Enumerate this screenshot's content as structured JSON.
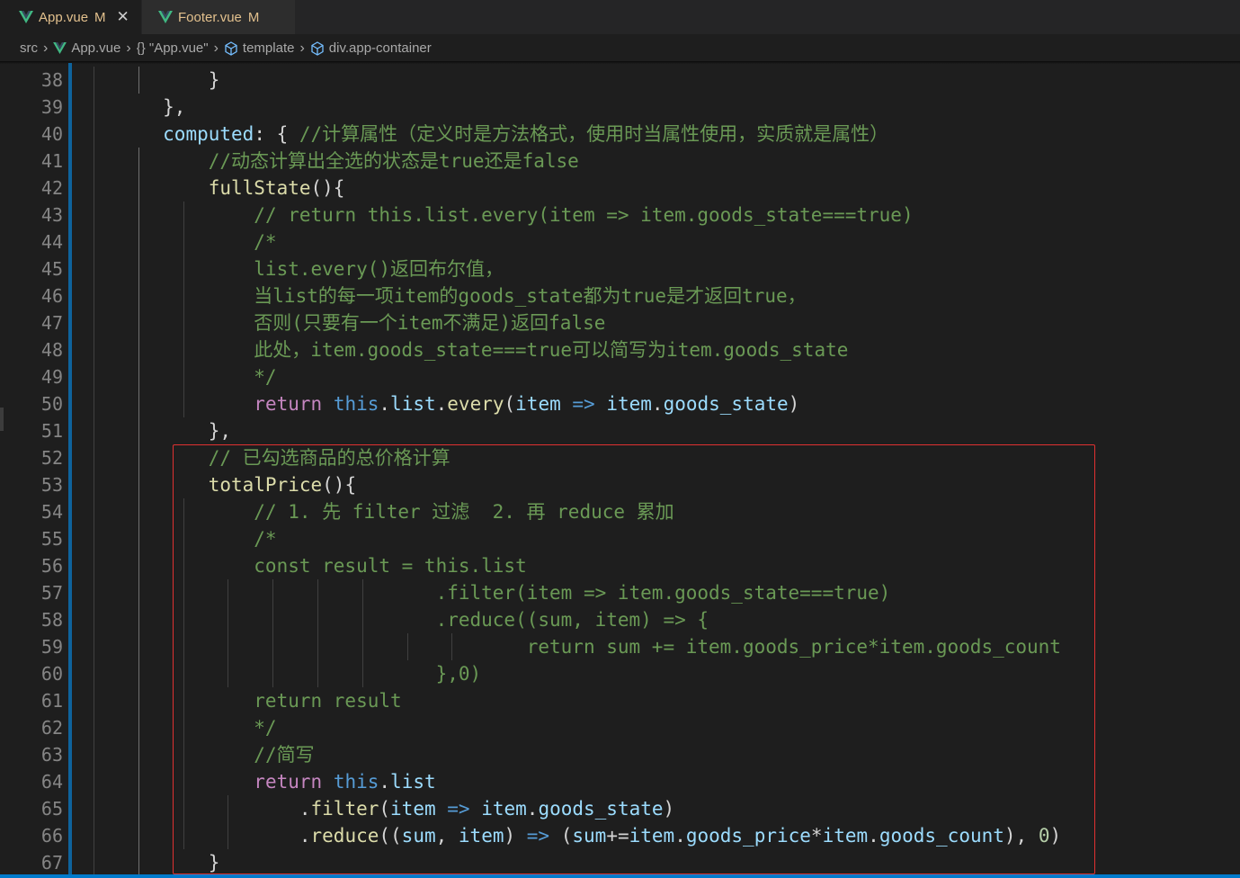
{
  "tabs": [
    {
      "name": "App.vue",
      "status": "M",
      "close": "✕"
    },
    {
      "name": "Footer.vue",
      "status": "M"
    }
  ],
  "breadcrumb": [
    "src",
    "App.vue",
    "{} \"App.vue\"",
    "template",
    "div.app-container"
  ],
  "lines": [
    {
      "n": "38",
      "text": "            }"
    },
    {
      "n": "39",
      "text": "        },"
    },
    {
      "n": "40",
      "text": "        computed: { //计算属性（定义时是方法格式，使用时当属性使用，实质就是属性）"
    },
    {
      "n": "41",
      "text": "            //动态计算出全选的状态是true还是false"
    },
    {
      "n": "42",
      "text": "            fullState(){"
    },
    {
      "n": "43",
      "text": "                // return this.list.every(item => item.goods_state===true)"
    },
    {
      "n": "44",
      "text": "                /*"
    },
    {
      "n": "45",
      "text": "                list.every()返回布尔值，"
    },
    {
      "n": "46",
      "text": "                当list的每一项item的goods_state都为true是才返回true，"
    },
    {
      "n": "47",
      "text": "                否则(只要有一个item不满足)返回false"
    },
    {
      "n": "48",
      "text": "                此处，item.goods_state===true可以简写为item.goods_state"
    },
    {
      "n": "49",
      "text": "                */"
    },
    {
      "n": "50",
      "text": "                return this.list.every(item => item.goods_state)"
    },
    {
      "n": "51",
      "text": "            },"
    },
    {
      "n": "52",
      "text": "            // 已勾选商品的总价格计算"
    },
    {
      "n": "53",
      "text": "            totalPrice(){"
    },
    {
      "n": "54",
      "text": "                // 1. 先 filter 过滤  2. 再 reduce 累加"
    },
    {
      "n": "55",
      "text": "                /*"
    },
    {
      "n": "56",
      "text": "                const result = this.list"
    },
    {
      "n": "57",
      "text": "                                .filter(item => item.goods_state===true)"
    },
    {
      "n": "58",
      "text": "                                .reduce((sum, item) => {"
    },
    {
      "n": "59",
      "text": "                                        return sum += item.goods_price*item.goods_count"
    },
    {
      "n": "60",
      "text": "                                },0)"
    },
    {
      "n": "61",
      "text": "                return result"
    },
    {
      "n": "62",
      "text": "                */"
    },
    {
      "n": "63",
      "text": "                //简写"
    },
    {
      "n": "64",
      "text": "                return this.list"
    },
    {
      "n": "65",
      "text": "                    .filter(item => item.goods_state)"
    },
    {
      "n": "66",
      "text": "                    .reduce((sum, item) => (sum+=item.goods_price*item.goods_count), 0)"
    },
    {
      "n": "67",
      "text": "            }"
    }
  ],
  "colors": {
    "comment": "#6a9955",
    "keyword": "#569cd6",
    "function": "#dcdcaa",
    "variable": "#9cdcfe",
    "number": "#b5cea8",
    "highlight_box": "#e03131",
    "modified": "#e2c08d",
    "vue": "#41b883"
  }
}
